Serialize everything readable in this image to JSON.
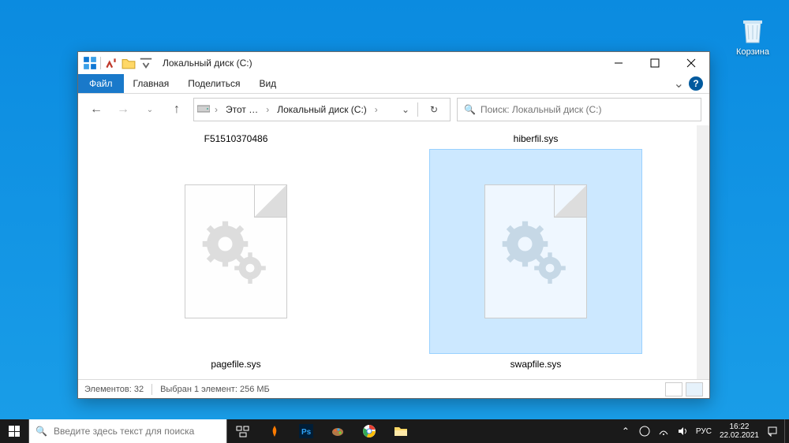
{
  "desktop": {
    "recycle_bin_label": "Корзина"
  },
  "window": {
    "title": "Локальный диск (C:)",
    "tabs": {
      "file": "Файл",
      "home": "Главная",
      "share": "Поделиться",
      "view": "Вид"
    },
    "breadcrumb": {
      "root": "Этот …",
      "current": "Локальный диск (C:)"
    },
    "search_placeholder": "Поиск: Локальный диск (C:)",
    "files": [
      {
        "top": "F51510370486",
        "bottom": "pagefile.sys",
        "selected": false
      },
      {
        "top": "hiberfil.sys",
        "bottom": "swapfile.sys",
        "selected": true
      }
    ],
    "status": {
      "count": "Элементов: 32",
      "selection": "Выбран 1 элемент: 256 МБ"
    }
  },
  "taskbar": {
    "search_placeholder": "Введите здесь текст для поиска",
    "lang": "РУС",
    "time": "16:22",
    "date": "22.02.2021"
  }
}
